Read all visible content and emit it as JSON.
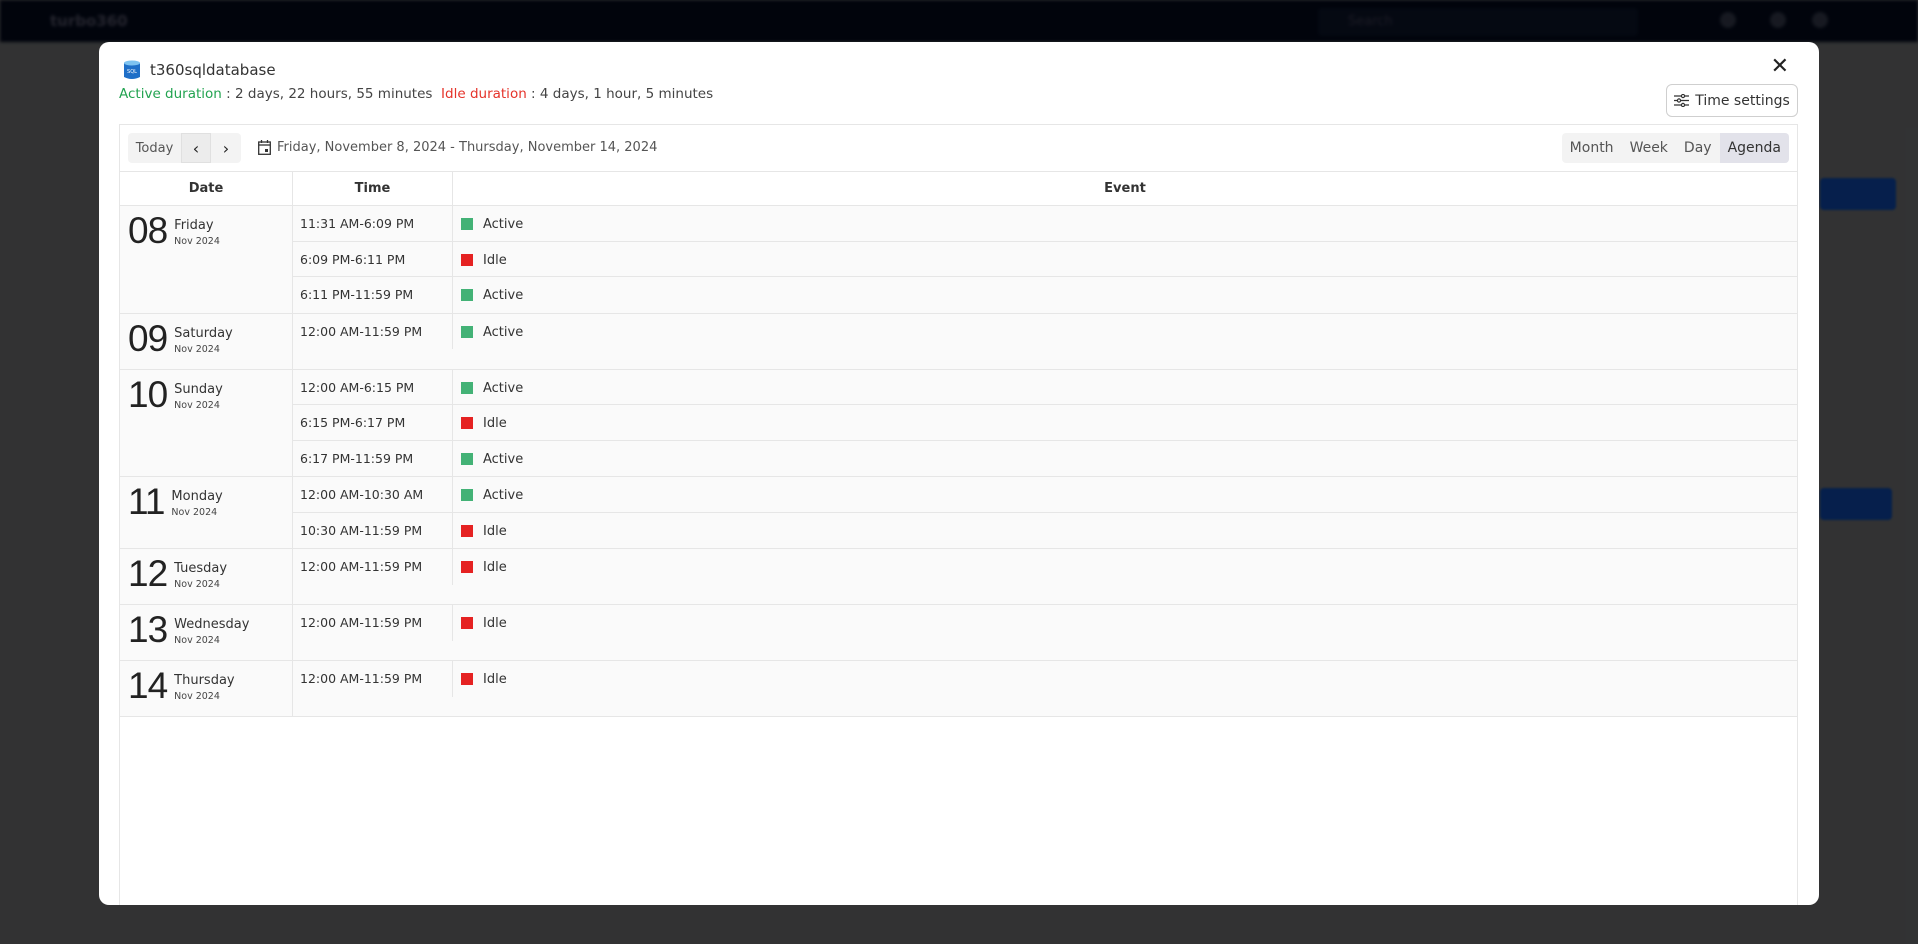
{
  "background": {
    "brand": "turbo360",
    "search_placeholder": "Search"
  },
  "modal": {
    "resource_name": "t360sqldatabase",
    "resource_icon": "sql-database-icon",
    "active_label": "Active duration",
    "active_value": " : 2 days, 22 hours, 55 minutes",
    "idle_label": "Idle duration",
    "idle_value": " : 4 days, 1 hour, 5 minutes",
    "time_settings_label": "Time settings",
    "close_icon": "close-icon"
  },
  "toolbar": {
    "today": "Today",
    "prev": "‹",
    "next": "›",
    "range": "Friday, November 8, 2024 - Thursday, November 14, 2024",
    "views": [
      "Month",
      "Week",
      "Day",
      "Agenda"
    ],
    "active_view": "Agenda"
  },
  "colors": {
    "active": "#43b276",
    "idle": "#e52222",
    "active_text": "#22a350",
    "idle_text": "#e5332a"
  },
  "table": {
    "headers": {
      "date": "Date",
      "time": "Time",
      "event": "Event"
    },
    "days": [
      {
        "num": "08",
        "name": "Friday",
        "month": "Nov 2024",
        "events": [
          {
            "time": "11:31 AM-6:09 PM",
            "status": "Active"
          },
          {
            "time": "6:09 PM-6:11 PM",
            "status": "Idle"
          },
          {
            "time": "6:11 PM-11:59 PM",
            "status": "Active"
          }
        ]
      },
      {
        "num": "09",
        "name": "Saturday",
        "month": "Nov 2024",
        "events": [
          {
            "time": "12:00 AM-11:59 PM",
            "status": "Active"
          }
        ]
      },
      {
        "num": "10",
        "name": "Sunday",
        "month": "Nov 2024",
        "events": [
          {
            "time": "12:00 AM-6:15 PM",
            "status": "Active"
          },
          {
            "time": "6:15 PM-6:17 PM",
            "status": "Idle"
          },
          {
            "time": "6:17 PM-11:59 PM",
            "status": "Active"
          }
        ]
      },
      {
        "num": "11",
        "name": "Monday",
        "month": "Nov 2024",
        "events": [
          {
            "time": "12:00 AM-10:30 AM",
            "status": "Active"
          },
          {
            "time": "10:30 AM-11:59 PM",
            "status": "Idle"
          }
        ]
      },
      {
        "num": "12",
        "name": "Tuesday",
        "month": "Nov 2024",
        "events": [
          {
            "time": "12:00 AM-11:59 PM",
            "status": "Idle"
          }
        ]
      },
      {
        "num": "13",
        "name": "Wednesday",
        "month": "Nov 2024",
        "events": [
          {
            "time": "12:00 AM-11:59 PM",
            "status": "Idle"
          }
        ]
      },
      {
        "num": "14",
        "name": "Thursday",
        "month": "Nov 2024",
        "events": [
          {
            "time": "12:00 AM-11:59 PM",
            "status": "Idle"
          }
        ]
      }
    ]
  }
}
